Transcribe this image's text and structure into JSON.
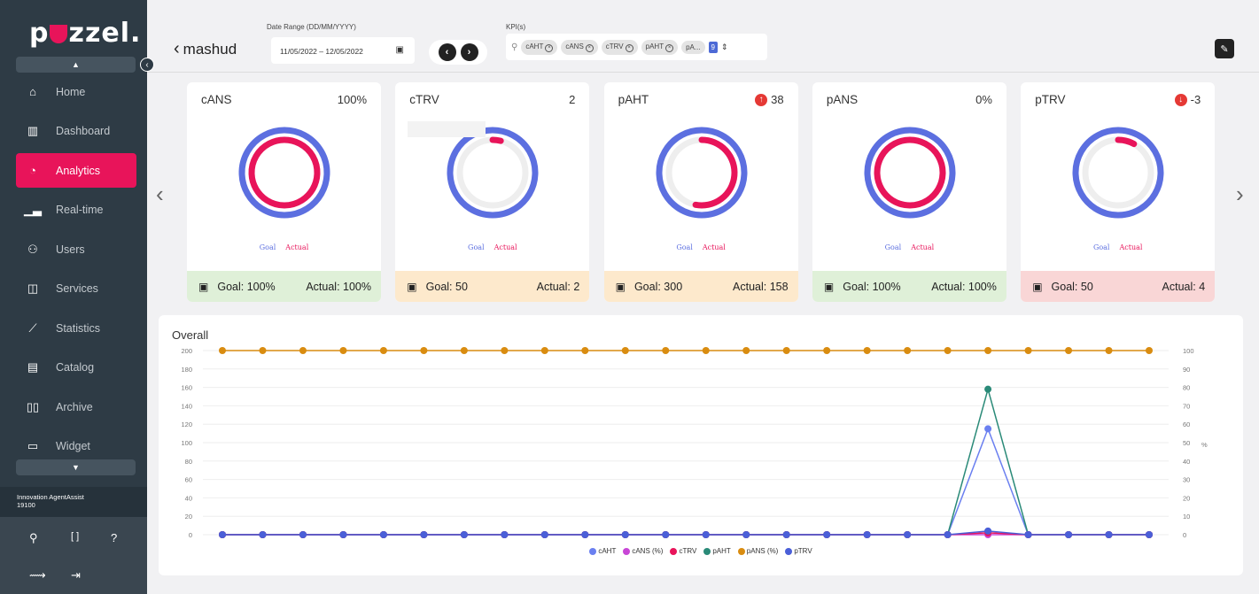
{
  "brand": {
    "logo_text_1": "p",
    "logo_text_2": "zzel."
  },
  "sidebar": {
    "items": [
      {
        "label": "Home",
        "icon": "home-icon",
        "glyph": "⌂"
      },
      {
        "label": "Dashboard",
        "icon": "dashboard-icon",
        "glyph": "▥"
      },
      {
        "label": "Analytics",
        "icon": "analytics-icon",
        "glyph": "◔",
        "active": true
      },
      {
        "label": "Real-time",
        "icon": "realtime-icon",
        "glyph": "▁▃"
      },
      {
        "label": "Users",
        "icon": "users-icon",
        "glyph": "⚇"
      },
      {
        "label": "Services",
        "icon": "services-icon",
        "glyph": "◫"
      },
      {
        "label": "Statistics",
        "icon": "statistics-icon",
        "glyph": "⟋"
      },
      {
        "label": "Catalog",
        "icon": "catalog-icon",
        "glyph": "▤"
      },
      {
        "label": "Archive",
        "icon": "archive-icon",
        "glyph": "▯▯"
      },
      {
        "label": "Widget",
        "icon": "widget-icon",
        "glyph": "▭"
      }
    ],
    "org_name": "Innovation AgentAssist",
    "org_id": "19100"
  },
  "header": {
    "back_label": "mashud",
    "date_range_label": "Date Range (DD/MM/YYYY)",
    "date_range_value": "11/05/2022 – 12/05/2022",
    "kpi_label": "KPI(s)",
    "kpi_chips": [
      "cAHT",
      "cANS",
      "cTRV",
      "pAHT",
      "pA..."
    ],
    "kpi_count": "9"
  },
  "cards": [
    {
      "name": "cANS",
      "value": "100%",
      "trend": "",
      "goal_text": "Goal: 100%",
      "actual_text": "Actual: 100%",
      "goal_frac": 1.0,
      "actual_frac": 1.0,
      "footer_color": "#dff0d8"
    },
    {
      "name": "cTRV",
      "value": "2",
      "trend": "",
      "goal_text": "Goal: 50",
      "actual_text": "Actual: 2",
      "goal_frac": 1.0,
      "actual_frac": 0.04,
      "footer_color": "#fde9cc"
    },
    {
      "name": "pAHT",
      "value": "38",
      "trend": "up",
      "goal_text": "Goal: 300",
      "actual_text": "Actual: 158",
      "goal_frac": 1.0,
      "actual_frac": 0.53,
      "footer_color": "#fde9cc"
    },
    {
      "name": "pANS",
      "value": "0%",
      "trend": "",
      "goal_text": "Goal: 100%",
      "actual_text": "Actual: 100%",
      "goal_frac": 1.0,
      "actual_frac": 1.0,
      "footer_color": "#dff0d8"
    },
    {
      "name": "pTRV",
      "value": "-3",
      "trend": "down",
      "goal_text": "Goal: 50",
      "actual_text": "Actual: 4",
      "goal_frac": 1.0,
      "actual_frac": 0.08,
      "footer_color": "#f9d6d6"
    }
  ],
  "donut_legend": {
    "goal": "Goal",
    "actual": "Actual"
  },
  "colors": {
    "accent": "#e8145a",
    "goal": "#5c6fe0",
    "sidebar": "#2e3b45"
  },
  "chart_data": {
    "type": "line",
    "title": "Overall",
    "xlabel": "",
    "ylabel": "",
    "y2label": "%",
    "ylim": [
      0,
      200
    ],
    "y2lim": [
      0,
      100
    ],
    "yticks": [
      0,
      20,
      40,
      60,
      80,
      100,
      120,
      140,
      160,
      180,
      200
    ],
    "y2ticks": [
      0,
      10,
      20,
      30,
      40,
      50,
      60,
      70,
      80,
      90,
      100
    ],
    "x": [
      1,
      2,
      3,
      4,
      5,
      6,
      7,
      8,
      9,
      10,
      11,
      12,
      13,
      14,
      15,
      16,
      17,
      18,
      19,
      20,
      21,
      22,
      23,
      24
    ],
    "series": [
      {
        "name": "cAHT",
        "axis": "left",
        "color": "#6a7ff0",
        "values": [
          0,
          0,
          0,
          0,
          0,
          0,
          0,
          0,
          0,
          0,
          0,
          0,
          0,
          0,
          0,
          0,
          0,
          0,
          0,
          115,
          0,
          0,
          0,
          0
        ]
      },
      {
        "name": "cANS (%)",
        "axis": "right",
        "color": "#c846d6",
        "values": [
          0,
          0,
          0,
          0,
          0,
          0,
          0,
          0,
          0,
          0,
          0,
          0,
          0,
          0,
          0,
          0,
          0,
          0,
          0,
          0,
          0,
          0,
          0,
          0
        ]
      },
      {
        "name": "cTRV",
        "axis": "left",
        "color": "#e8145a",
        "values": [
          0,
          0,
          0,
          0,
          0,
          0,
          0,
          0,
          0,
          0,
          0,
          0,
          0,
          0,
          0,
          0,
          0,
          0,
          0,
          2,
          0,
          0,
          0,
          0
        ]
      },
      {
        "name": "pAHT",
        "axis": "left",
        "color": "#2a8a78",
        "values": [
          0,
          0,
          0,
          0,
          0,
          0,
          0,
          0,
          0,
          0,
          0,
          0,
          0,
          0,
          0,
          0,
          0,
          0,
          0,
          158,
          0,
          0,
          0,
          0
        ]
      },
      {
        "name": "pANS (%)",
        "axis": "right",
        "color": "#d98c10",
        "values": [
          100,
          100,
          100,
          100,
          100,
          100,
          100,
          100,
          100,
          100,
          100,
          100,
          100,
          100,
          100,
          100,
          100,
          100,
          100,
          100,
          100,
          100,
          100,
          100
        ]
      },
      {
        "name": "pTRV",
        "axis": "left",
        "color": "#4a5fd8",
        "values": [
          0,
          0,
          0,
          0,
          0,
          0,
          0,
          0,
          0,
          0,
          0,
          0,
          0,
          0,
          0,
          0,
          0,
          0,
          0,
          4,
          0,
          0,
          0,
          0
        ]
      }
    ]
  }
}
